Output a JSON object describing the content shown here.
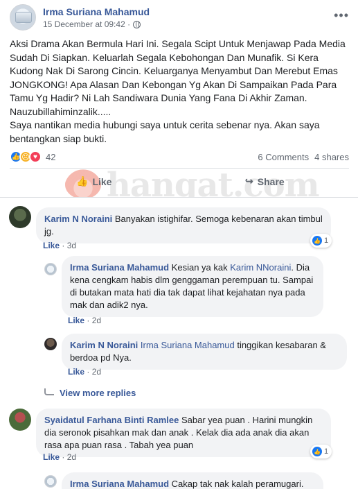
{
  "post": {
    "author": "Irma Suriana Mahamud",
    "date": "15 December at 09:42 ·",
    "body": "Aksi Drama Akan Bermula Hari Ini. Segala Scipt Untuk Menjawap Pada Media Sudah Di Siapkan. Keluarlah Segala Kebohongan Dan Munafik. Si Kera Kudong Nak Di Sarong Cincin. Keluarganya Menyambut Dan Merebut Emas JONGKONG! Apa Alasan Dan Kebongan Yg Akan Di Sampaikan Pada Para Tamu Yg Hadir? Ni Lah Sandiwara Dunia Yang Fana Di Akhir Zaman. Nauzubillahiminzalik.....\nSaya nantikan media hubungi saya untuk cerita sebenar nya. Akan saya bentangkan siap bukti.",
    "reaction_count": "42",
    "comments_count": "6 Comments",
    "shares_count": "4 shares",
    "more_icon": "more-horizontal-icon"
  },
  "actions": {
    "like": "Like",
    "share": "Share",
    "watermark": "hangat.com"
  },
  "comments": [
    {
      "author": "Karim N Noraini",
      "text": "Banyakan istighifar. Semoga kebenaran akan timbul jg.",
      "like": "Like",
      "time": "3d",
      "reactions": "1"
    },
    {
      "author": "Irma Suriana Mahamud",
      "text_before": "Kesian ya kak ",
      "mention": "Karim NNoraini",
      "text_after": ". Dia kena cengkam habis dlm genggaman perempuan tu. Sampai di butakan mata hati dia tak dapat lihat kejahatan nya pada mak dan adik2 nya.",
      "like": "Like",
      "time": "2d"
    },
    {
      "author": "Karim N Noraini",
      "mention": "Irma Suriana Mahamud",
      "text_after": " tinggikan kesabaran & berdoa pd Nya.",
      "like": "Like",
      "time": "2d"
    },
    {
      "author": "Syaidatul Farhana Binti Ramlee",
      "text": "Sabar yea puan . Harini mungkin dia seronok pisahkan mak dan anak . Kelak dia ada anak dia akan rasa apa puan rasa . Tabah yea puan",
      "like": "Like",
      "time": "2d",
      "reactions": "1"
    },
    {
      "author": "Irma Suriana Mahamud",
      "text": "Cakap tak nak kalah peramugari."
    }
  ],
  "view_more": "View more replies"
}
